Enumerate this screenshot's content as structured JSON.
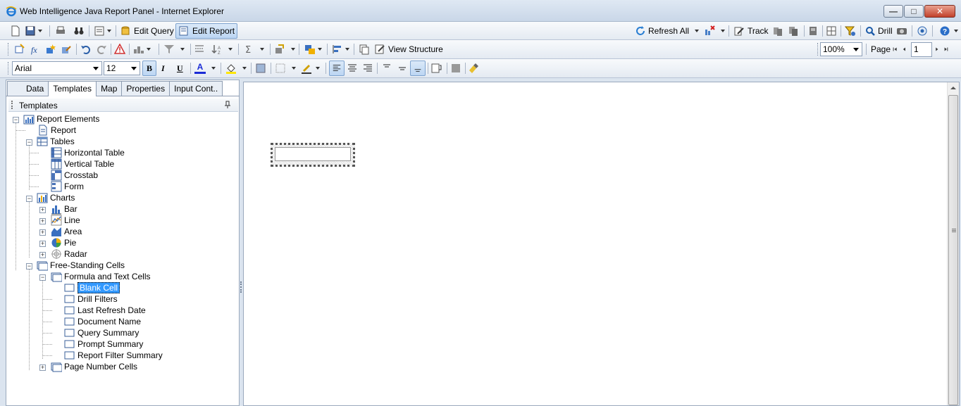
{
  "window": {
    "title": "Web Intelligence Java Report Panel - Internet Explorer",
    "buttons": {
      "minimize": "—",
      "maximize": "□",
      "close": "✕"
    }
  },
  "toolbar1": {
    "edit_query": "Edit Query",
    "edit_report": "Edit Report",
    "refresh_all": "Refresh All",
    "track": "Track",
    "drill": "Drill"
  },
  "toolbar2": {
    "view_structure": "View Structure",
    "zoom": "100%",
    "page_label": "Page",
    "page_number": "1"
  },
  "toolbar3": {
    "font": "Arial",
    "size": "12",
    "bold": "B",
    "italic": "I",
    "underline": "U",
    "font_color_glyph": "A"
  },
  "tabs": [
    "Data",
    "Templates",
    "Map",
    "Properties",
    "Input Cont.."
  ],
  "panel": {
    "title": "Templates"
  },
  "tree": {
    "report_elements": "Report Elements",
    "report": "Report",
    "tables": "Tables",
    "horizontal_table": "Horizontal Table",
    "vertical_table": "Vertical Table",
    "crosstab": "Crosstab",
    "form": "Form",
    "charts": "Charts",
    "bar": "Bar",
    "line": "Line",
    "area": "Area",
    "pie": "Pie",
    "radar": "Radar",
    "free_standing_cells": "Free-Standing Cells",
    "formula_text_cells": "Formula and Text Cells",
    "blank_cell": "Blank Cell",
    "drill_filters": "Drill Filters",
    "last_refresh_date": "Last Refresh Date",
    "document_name": "Document Name",
    "query_summary": "Query Summary",
    "prompt_summary": "Prompt Summary",
    "report_filter_summary": "Report Filter Summary",
    "page_number_cells": "Page Number Cells"
  },
  "colors": {
    "selection": "#3399ff",
    "font_color": "#1a2bd6",
    "fill_color": "#ffe600"
  }
}
